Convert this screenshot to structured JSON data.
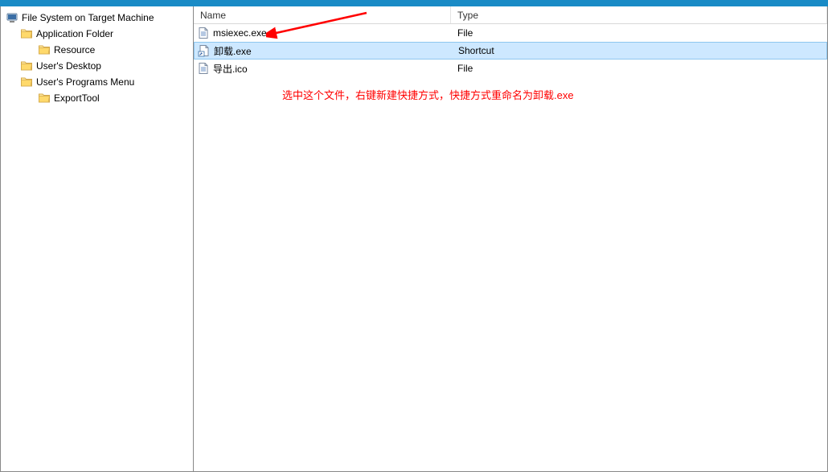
{
  "tree": {
    "root": "File System on Target Machine",
    "items": [
      {
        "label": "Application Folder",
        "indent": 1,
        "icon": "folder"
      },
      {
        "label": "Resource",
        "indent": 2,
        "icon": "folder"
      },
      {
        "label": "User's Desktop",
        "indent": 1,
        "icon": "folder"
      },
      {
        "label": "User's Programs Menu",
        "indent": 1,
        "icon": "folder"
      },
      {
        "label": "ExportTool",
        "indent": 2,
        "icon": "folder"
      }
    ]
  },
  "columns": {
    "name": "Name",
    "type": "Type"
  },
  "files": [
    {
      "name": "msiexec.exe",
      "type": "File",
      "icon": "file",
      "selected": false
    },
    {
      "name": "卸载.exe",
      "type": "Shortcut",
      "icon": "shortcut",
      "selected": true
    },
    {
      "name": "导出.ico",
      "type": "File",
      "icon": "file",
      "selected": false
    }
  ],
  "annotation": {
    "text": "选中这个文件，右键新建快捷方式，快捷方式重命名为卸载.exe"
  }
}
